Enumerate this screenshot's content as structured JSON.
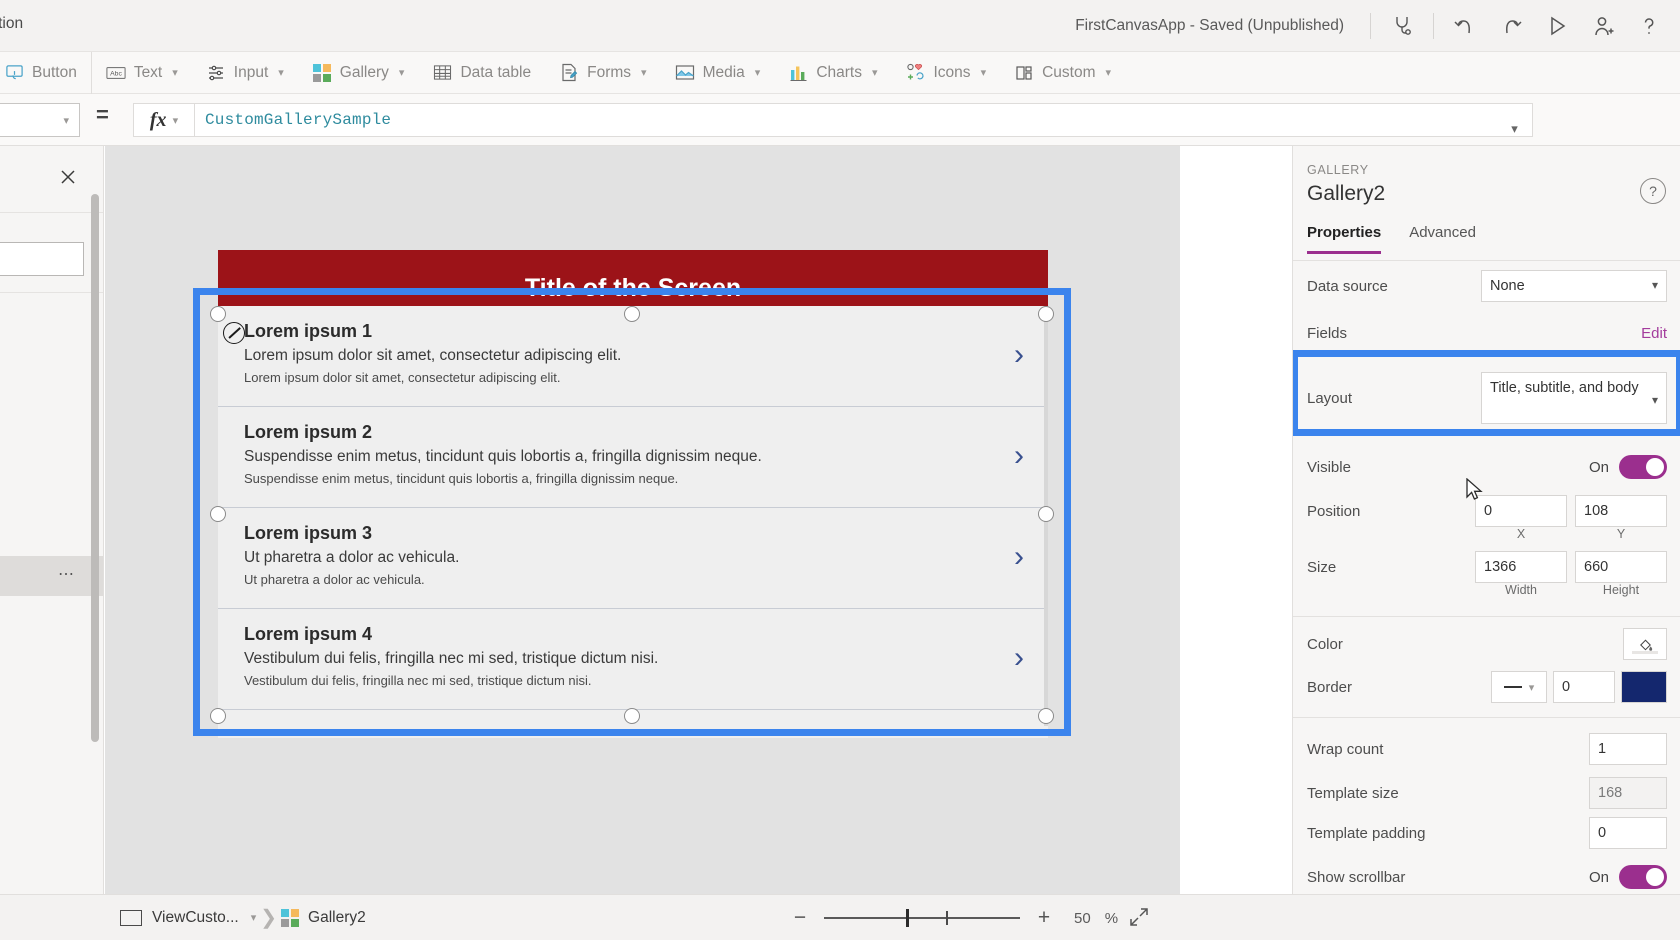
{
  "topbar": {
    "left_label": "Action",
    "app_title": "FirstCanvasApp - Saved (Unpublished)",
    "icons": [
      {
        "name": "app-checker-icon",
        "label": "App checker"
      },
      {
        "name": "undo-icon",
        "label": "Undo"
      },
      {
        "name": "redo-icon",
        "label": "Redo"
      },
      {
        "name": "preview-play-icon",
        "label": "Preview the app"
      },
      {
        "name": "share-user-icon",
        "label": "Share"
      },
      {
        "name": "help-icon",
        "label": "Help"
      }
    ]
  },
  "ribbon": {
    "items": [
      {
        "label": "Button",
        "icon": "button-icon",
        "caret": false
      },
      {
        "label": "Text",
        "icon": "text-abc-icon",
        "caret": true
      },
      {
        "label": "Input",
        "icon": "input-sliders-icon",
        "caret": true
      },
      {
        "label": "Gallery",
        "icon": "gallery-icon",
        "caret": true
      },
      {
        "label": "Data table",
        "icon": "data-table-icon",
        "caret": false
      },
      {
        "label": "Forms",
        "icon": "forms-icon",
        "caret": true
      },
      {
        "label": "Media",
        "icon": "media-icon",
        "caret": true
      },
      {
        "label": "Charts",
        "icon": "charts-icon",
        "caret": true
      },
      {
        "label": "Icons",
        "icon": "icons-icon",
        "caret": true
      },
      {
        "label": "Custom",
        "icon": "custom-icon",
        "caret": true
      }
    ]
  },
  "formula_bar": {
    "equals": "=",
    "fx_label": "fx",
    "value": "CustomGallerySample",
    "property_selected": ""
  },
  "canvas": {
    "screen_title": "Title of the Screen",
    "screen_title_bg": "#9c1318",
    "selection_color": "#3b84ed",
    "gallery_items": [
      {
        "title": "Lorem ipsum 1",
        "subtitle": "Lorem ipsum dolor sit amet, consectetur adipiscing elit.",
        "body": "Lorem ipsum dolor sit amet, consectetur adipiscing elit."
      },
      {
        "title": "Lorem ipsum 2",
        "subtitle": "Suspendisse enim metus, tincidunt quis lobortis a, fringilla dignissim neque.",
        "body": "Suspendisse enim metus, tincidunt quis lobortis a, fringilla dignissim neque."
      },
      {
        "title": "Lorem ipsum 3",
        "subtitle": "Ut pharetra a dolor ac vehicula.",
        "body": "Ut pharetra a dolor ac vehicula."
      },
      {
        "title": "Lorem ipsum 4",
        "subtitle": "Vestibulum dui felis, fringilla nec mi sed, tristique dictum nisi.",
        "body": "Vestibulum dui felis, fringilla nec mi sed, tristique dictum nisi."
      }
    ],
    "chevron_glyph": "›"
  },
  "right_panel": {
    "kicker": "GALLERY",
    "name": "Gallery2",
    "help_glyph": "?",
    "tabs": [
      {
        "label": "Properties",
        "active": true
      },
      {
        "label": "Advanced",
        "active": false
      }
    ],
    "rows": {
      "data_source_label": "Data source",
      "data_source_value": "None",
      "fields_label": "Fields",
      "fields_edit": "Edit",
      "layout_label": "Layout",
      "layout_value": "Title, subtitle, and body",
      "visible_label": "Visible",
      "visible_state": "On",
      "position_label": "Position",
      "position_x": "0",
      "position_y": "108",
      "position_x_caption": "X",
      "position_y_caption": "Y",
      "size_label": "Size",
      "size_width": "1366",
      "size_height": "660",
      "size_width_caption": "Width",
      "size_height_caption": "Height",
      "color_label": "Color",
      "border_label": "Border",
      "border_thickness": "0",
      "border_color_hex": "#14276e",
      "wrap_count_label": "Wrap count",
      "wrap_count_value": "1",
      "template_size_label": "Template size",
      "template_size_value": "168",
      "template_padding_label": "Template padding",
      "template_padding_value": "0",
      "show_scrollbar_label": "Show scrollbar",
      "show_scrollbar_state": "On"
    },
    "accent_color": "#9b2f8e"
  },
  "status_bar": {
    "screen_name": "ViewCusto...",
    "breadcrumb_control": "Gallery2",
    "zoom_minus": "−",
    "zoom_plus": "+",
    "zoom_value": "50",
    "zoom_unit": "%"
  }
}
